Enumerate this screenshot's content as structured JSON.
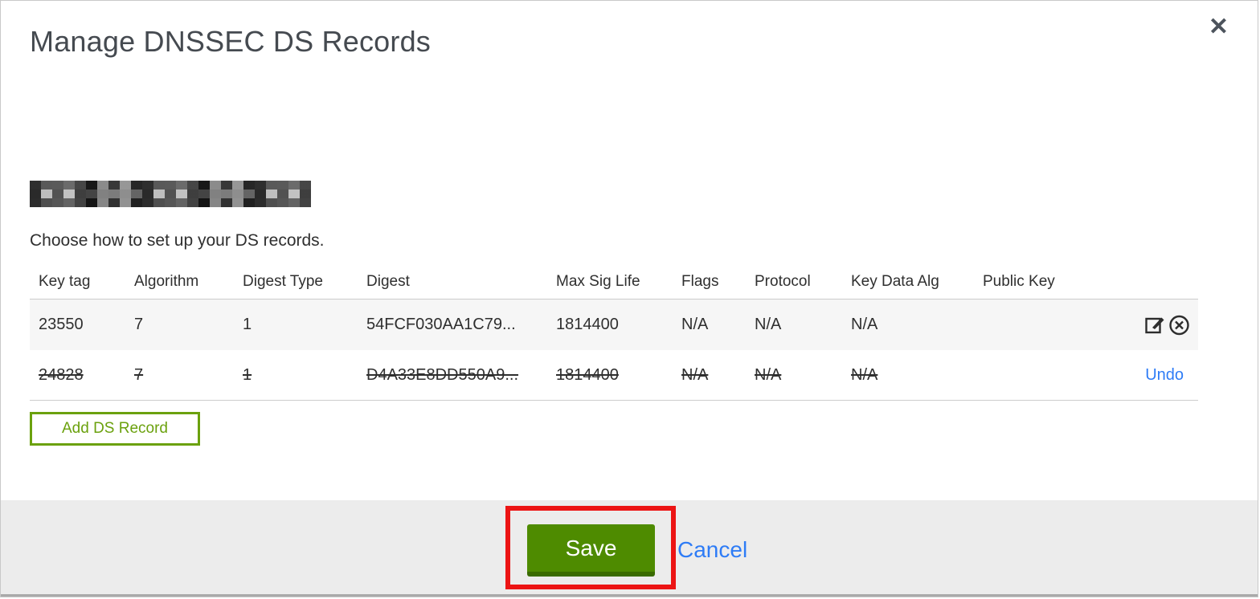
{
  "modal": {
    "title": "Manage DNSSEC DS Records",
    "close_glyph": "✕",
    "subtitle": "Choose how to set up your DS records.",
    "domain_redacted": true
  },
  "table": {
    "headers": [
      "Key tag",
      "Algorithm",
      "Digest Type",
      "Digest",
      "Max Sig Life",
      "Flags",
      "Protocol",
      "Key Data Alg",
      "Public Key"
    ],
    "rows": [
      {
        "key_tag": "23550",
        "algorithm": "7",
        "digest_type": "1",
        "digest": "54FCF030AA1C79...",
        "max_sig_life": "1814400",
        "flags": "N/A",
        "protocol": "N/A",
        "key_data_alg": "N/A",
        "public_key": "",
        "state": "active"
      },
      {
        "key_tag": "24828",
        "algorithm": "7",
        "digest_type": "1",
        "digest": "D4A33E8DD550A9...",
        "max_sig_life": "1814400",
        "flags": "N/A",
        "protocol": "N/A",
        "key_data_alg": "N/A",
        "public_key": "",
        "state": "deleted",
        "undo_label": "Undo"
      }
    ]
  },
  "buttons": {
    "add_ds_record": "Add DS Record",
    "save": "Save",
    "cancel": "Cancel"
  },
  "icons": {
    "close": "close-icon",
    "edit": "edit-record-icon",
    "remove": "remove-record-icon"
  },
  "colors": {
    "save_green": "#4e8b00",
    "outline_green": "#6ba10e",
    "link_blue": "#2e7cf6",
    "annotation_red": "#ec1414",
    "row_stripe": "#f6f6f6",
    "footer_gray": "#ececec"
  }
}
